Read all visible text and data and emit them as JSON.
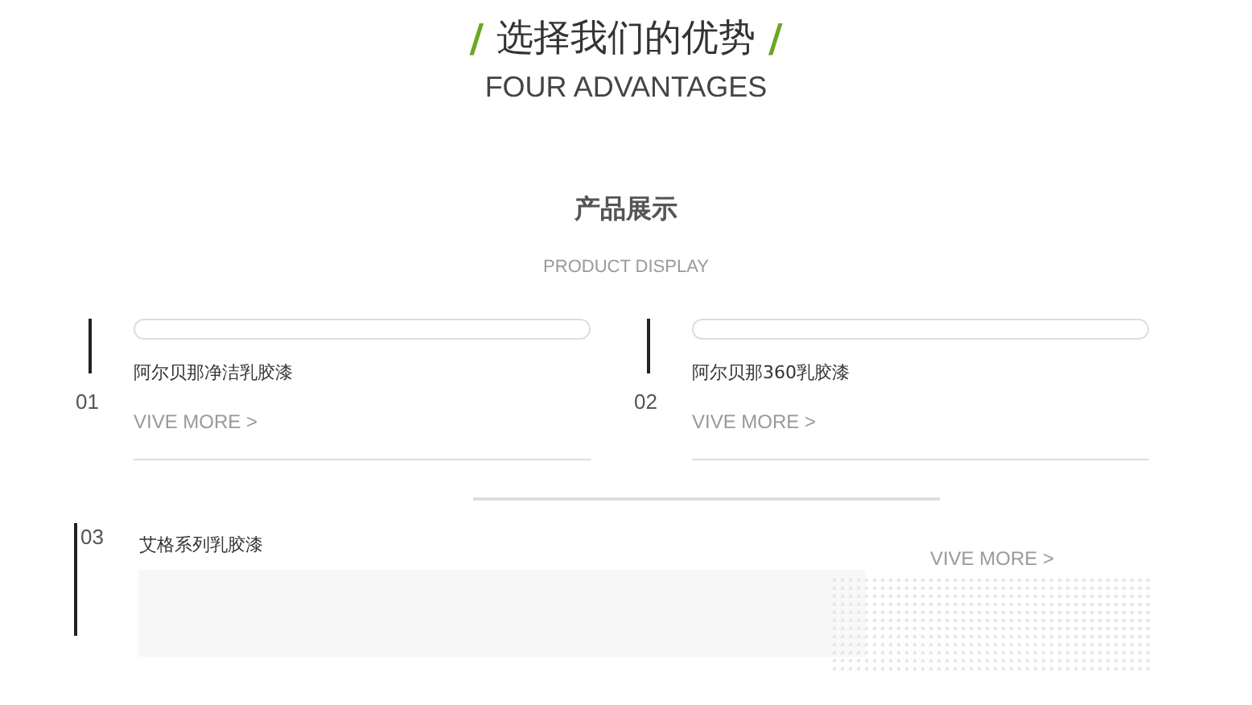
{
  "header": {
    "left_mark": "/",
    "title": "选择我们的优势",
    "right_mark": "/",
    "subtitle": "FOUR ADVANTAGES"
  },
  "section": {
    "title": "产品展示",
    "subtitle": "PRODUCT DISPLAY"
  },
  "products": [
    {
      "kind": "card",
      "number": "01",
      "name": "阿尔贝那净洁乳胶漆",
      "link": "VIVE MORE >"
    },
    {
      "kind": "card",
      "number": "02",
      "name": "阿尔贝那360乳胶漆",
      "link": "VIVE MORE >"
    },
    {
      "kind": "wide",
      "number": "03",
      "name": "艾格系列乳胶漆",
      "link": "VIVE MORE >"
    }
  ]
}
